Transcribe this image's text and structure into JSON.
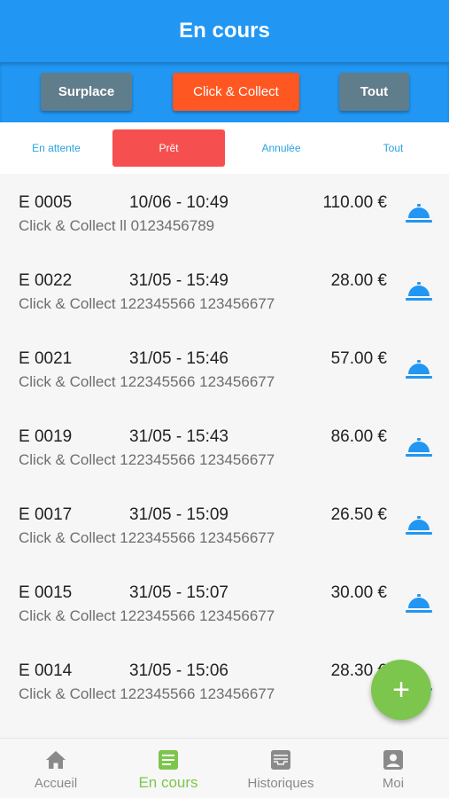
{
  "header": {
    "title": "En cours"
  },
  "filters": {
    "surplace": "Surplace",
    "click_collect": "Click & Collect",
    "tout": "Tout",
    "active": "Click & Collect"
  },
  "status_tabs": {
    "en_attente": "En attente",
    "pret": "Prêt",
    "annulee": "Annulée",
    "tout": "Tout",
    "active": "Prêt"
  },
  "orders": [
    {
      "code": "E 0005",
      "date": "10/06 - 10:49",
      "amount": "110.00 €",
      "subtitle": "Click & Collect ll 0123456789",
      "icon": "service-bell-icon"
    },
    {
      "code": "E 0022",
      "date": "31/05 - 15:49",
      "amount": "28.00 €",
      "subtitle": "Click & Collect 122345566 123456677",
      "icon": "service-bell-icon"
    },
    {
      "code": "E 0021",
      "date": "31/05 - 15:46",
      "amount": "57.00 €",
      "subtitle": "Click & Collect 122345566 123456677",
      "icon": "service-bell-icon"
    },
    {
      "code": "E 0019",
      "date": "31/05 - 15:43",
      "amount": "86.00 €",
      "subtitle": "Click & Collect 122345566 123456677",
      "icon": "service-bell-icon"
    },
    {
      "code": "E 0017",
      "date": "31/05 - 15:09",
      "amount": "26.50 €",
      "subtitle": "Click & Collect 122345566 123456677",
      "icon": "service-bell-icon"
    },
    {
      "code": "E 0015",
      "date": "31/05 - 15:07",
      "amount": "30.00 €",
      "subtitle": "Click & Collect 122345566 123456677",
      "icon": "service-bell-icon"
    },
    {
      "code": "E 0014",
      "date": "31/05 - 15:06",
      "amount": "28.30 €",
      "subtitle": "Click & Collect 122345566 123456677",
      "icon": "service-bell-icon"
    }
  ],
  "fab": {
    "label": "+",
    "icon": "plus-icon"
  },
  "tabbar": {
    "accueil": "Accueil",
    "en_cours": "En cours",
    "historiques": "Historiques",
    "moi": "Moi",
    "active": "En cours"
  },
  "colors": {
    "primary": "#2196f3",
    "accent_orange": "#ff5722",
    "button_grey": "#607d8b",
    "status_active": "#f5504f",
    "status_text": "#29a3e0",
    "green": "#7dc64d"
  }
}
